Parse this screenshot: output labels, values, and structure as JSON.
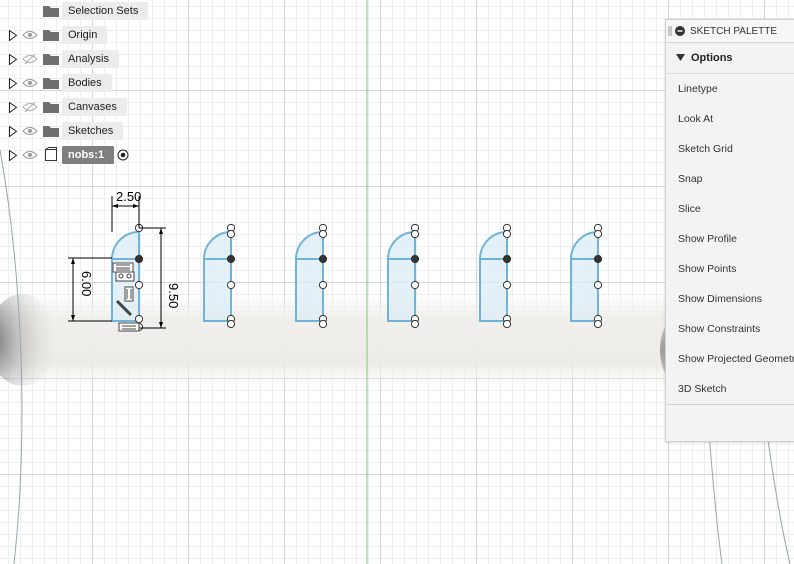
{
  "browser": {
    "items": [
      {
        "label": "Selection Sets",
        "eye": "none",
        "icon": "folder-icon"
      },
      {
        "label": "Origin",
        "eye": "visible",
        "icon": "folder-icon"
      },
      {
        "label": "Analysis",
        "eye": "hidden",
        "icon": "folder-icon"
      },
      {
        "label": "Bodies",
        "eye": "visible",
        "icon": "folder-icon"
      },
      {
        "label": "Canvases",
        "eye": "hidden",
        "icon": "folder-icon"
      },
      {
        "label": "Sketches",
        "eye": "visible",
        "icon": "folder-icon"
      },
      {
        "label": "nobs:1",
        "eye": "visible",
        "icon": "component-icon",
        "active": true
      }
    ]
  },
  "dimensions": {
    "width_top": "2.50",
    "height_left": "6.00",
    "height_right": "9.50"
  },
  "palette": {
    "title": "SKETCH PALETTE",
    "section": "Options",
    "options": [
      "Linetype",
      "Look At",
      "Sketch Grid",
      "Snap",
      "Slice",
      "Show Profile",
      "Show Points",
      "Show Dimensions",
      "Show Constraints",
      "Show Projected Geometries",
      "3D Sketch"
    ]
  },
  "colors": {
    "sketch_line": "#6fb3d9",
    "profile_fill": "#dcecf6",
    "grid_major": "#cfd6dc",
    "grid_minor": "#eceff2",
    "axis": "#7dc87d",
    "palette_bg": "#f3f3f3"
  }
}
